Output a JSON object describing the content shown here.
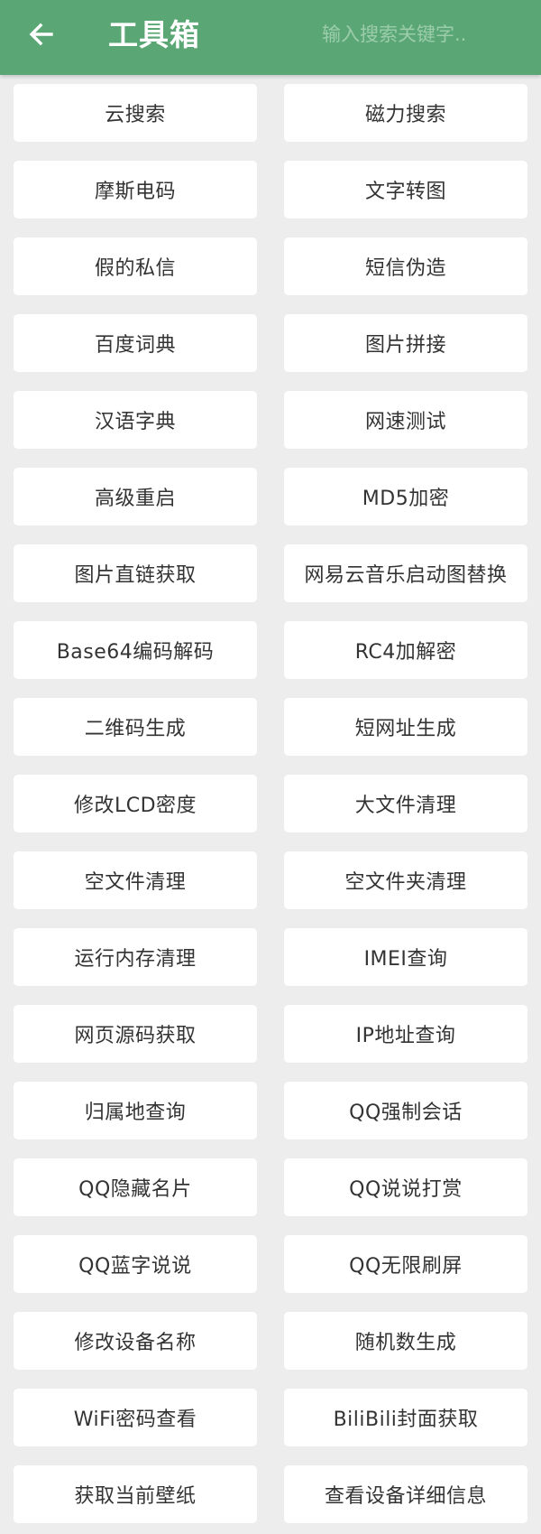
{
  "header": {
    "back_icon": "arrow-left-icon",
    "title": "工具箱",
    "search_placeholder": "输入搜索关键字.."
  },
  "colors": {
    "app_bar": "#5aa775",
    "background": "#ededed",
    "card": "#ffffff",
    "text": "#333333"
  },
  "tools": [
    {
      "label": "云搜索"
    },
    {
      "label": "磁力搜索"
    },
    {
      "label": "摩斯电码"
    },
    {
      "label": "文字转图"
    },
    {
      "label": "假的私信"
    },
    {
      "label": "短信伪造"
    },
    {
      "label": "百度词典"
    },
    {
      "label": "图片拼接"
    },
    {
      "label": "汉语字典"
    },
    {
      "label": "网速测试"
    },
    {
      "label": "高级重启"
    },
    {
      "label": "MD5加密"
    },
    {
      "label": "图片直链获取"
    },
    {
      "label": "网易云音乐启动图替换"
    },
    {
      "label": "Base64编码解码"
    },
    {
      "label": "RC4加解密"
    },
    {
      "label": "二维码生成"
    },
    {
      "label": "短网址生成"
    },
    {
      "label": "修改LCD密度"
    },
    {
      "label": "大文件清理"
    },
    {
      "label": "空文件清理"
    },
    {
      "label": "空文件夹清理"
    },
    {
      "label": "运行内存清理"
    },
    {
      "label": "IMEI查询"
    },
    {
      "label": "网页源码获取"
    },
    {
      "label": "IP地址查询"
    },
    {
      "label": "归属地查询"
    },
    {
      "label": "QQ强制会话"
    },
    {
      "label": "QQ隐藏名片"
    },
    {
      "label": "QQ说说打赏"
    },
    {
      "label": "QQ蓝字说说"
    },
    {
      "label": "QQ无限刷屏"
    },
    {
      "label": "修改设备名称"
    },
    {
      "label": "随机数生成"
    },
    {
      "label": "WiFi密码查看"
    },
    {
      "label": "BiliBili封面获取"
    },
    {
      "label": "获取当前壁纸"
    },
    {
      "label": "查看设备详细信息"
    }
  ]
}
